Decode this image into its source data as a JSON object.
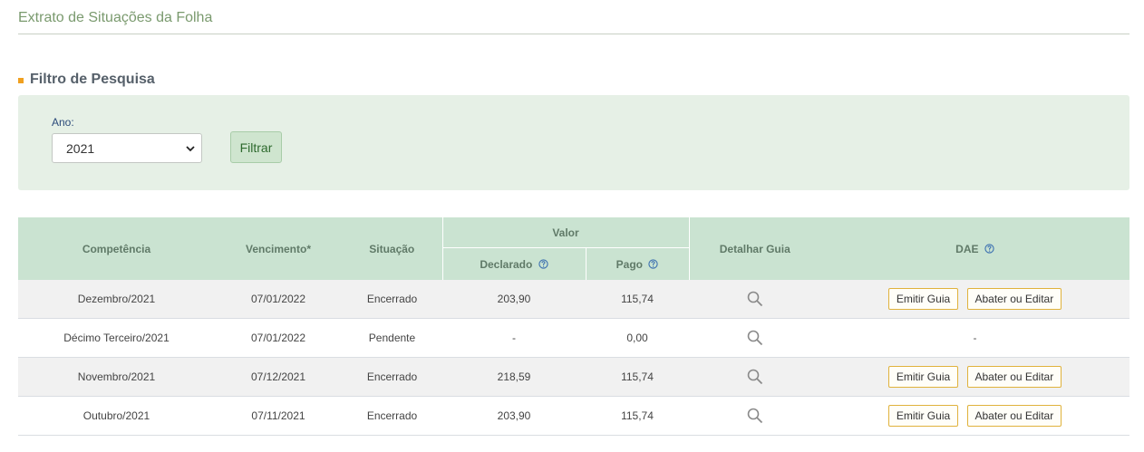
{
  "page_title": "Extrato de Situações da Folha",
  "filter": {
    "section_title": "Filtro de Pesquisa",
    "year_label": "Ano:",
    "year_value": "2021",
    "filter_button": "Filtrar"
  },
  "table": {
    "headers": {
      "competencia": "Competência",
      "vencimento": "Vencimento*",
      "situacao": "Situação",
      "valor": "Valor",
      "declarado": "Declarado",
      "pago": "Pago",
      "detalhar": "Detalhar Guia",
      "dae": "DAE"
    },
    "rows": [
      {
        "competencia": "Dezembro/2021",
        "vencimento": "07/01/2022",
        "situacao": "Encerrado",
        "declarado": "203,90",
        "pago": "115,74",
        "dae_emitir": "Emitir Guia",
        "dae_abater": "Abater ou Editar"
      },
      {
        "competencia": "Décimo Terceiro/2021",
        "vencimento": "07/01/2022",
        "situacao": "Pendente",
        "declarado": "-",
        "pago": "0,00",
        "dae_dash": "-"
      },
      {
        "competencia": "Novembro/2021",
        "vencimento": "07/12/2021",
        "situacao": "Encerrado",
        "declarado": "218,59",
        "pago": "115,74",
        "dae_emitir": "Emitir Guia",
        "dae_abater": "Abater ou Editar"
      },
      {
        "competencia": "Outubro/2021",
        "vencimento": "07/11/2021",
        "situacao": "Encerrado",
        "declarado": "203,90",
        "pago": "115,74",
        "dae_emitir": "Emitir Guia",
        "dae_abater": "Abater ou Editar"
      }
    ]
  },
  "icons": {
    "detail": "magnifier-icon",
    "help": "question-circle-icon",
    "section_bullet": "square-bullet-icon",
    "select_chevron": "chevron-down-icon"
  },
  "colors": {
    "title_green": "#7a9a6e",
    "filter_bg": "#e6f0e6",
    "header_bg": "#cae3d1",
    "link_blue": "#2b4f8a",
    "bullet_orange": "#f0a020",
    "dae_button_border": "#e0b23c"
  }
}
